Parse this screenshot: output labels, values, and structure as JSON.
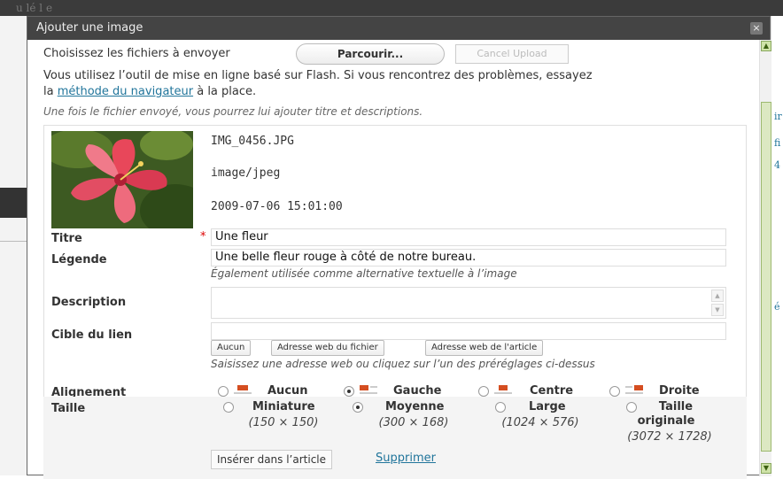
{
  "background": {
    "top_text": "u lé l e",
    "right_marks": [
      "ir",
      "fi",
      "4",
      "é"
    ]
  },
  "modal": {
    "title": "Ajouter une image",
    "close_label": "×"
  },
  "upload": {
    "choose_label": "Choisissez les fichiers à envoyer",
    "browse_button": "Parcourir...",
    "cancel_button": "Cancel Upload",
    "flash_note_1": "Vous utilisez l’outil de mise en ligne basé sur Flash. Si vous rencontrez des problèmes, essayez",
    "flash_note_pre": "la ",
    "flash_link": "méthode du navigateur",
    "flash_note_post": " à la place.",
    "after_note": "Une fois le fichier envoyé, vous pourrez lui ajouter titre et descriptions."
  },
  "file": {
    "name": "IMG_0456.JPG",
    "mime": "image/jpeg",
    "date": "2009-07-06 15:01:00"
  },
  "form": {
    "title_label": "Titre",
    "required_mark": "*",
    "title_value": "Une fleur",
    "caption_label": "Légende",
    "caption_value": "Une belle fleur rouge à côté de notre bureau.",
    "caption_help": "Également utilisée comme alternative textuelle à l’image",
    "description_label": "Description",
    "link_label": "Cible du lien",
    "link_value": "",
    "link_btn_none": "Aucun",
    "link_btn_file": "Adresse web du fichier",
    "link_btn_post": "Adresse web de l'article",
    "link_help": "Saisissez une adresse web ou cliquez sur l’un des préréglages ci-dessus"
  },
  "alignment": {
    "label": "Alignement",
    "options": [
      "Aucun",
      "Gauche",
      "Centre",
      "Droite"
    ],
    "selected": "Gauche"
  },
  "size": {
    "label": "Taille",
    "options": [
      {
        "name": "Miniature",
        "dims": "(150 × 150)"
      },
      {
        "name": "Moyenne",
        "dims": "(300 × 168)"
      },
      {
        "name": "Large",
        "dims": "(1024 × 576)"
      },
      {
        "name": "Taille originale",
        "name_1": "Taille",
        "name_2": "originale",
        "dims": "(3072 × 1728)"
      }
    ],
    "selected": "Moyenne"
  },
  "actions": {
    "insert": "Insérer dans l’article",
    "delete": "Supprimer"
  },
  "colors": {
    "link": "#21759b",
    "titlebar": "#444444",
    "required": "#dd0000",
    "align_icon": "#d54e21"
  }
}
